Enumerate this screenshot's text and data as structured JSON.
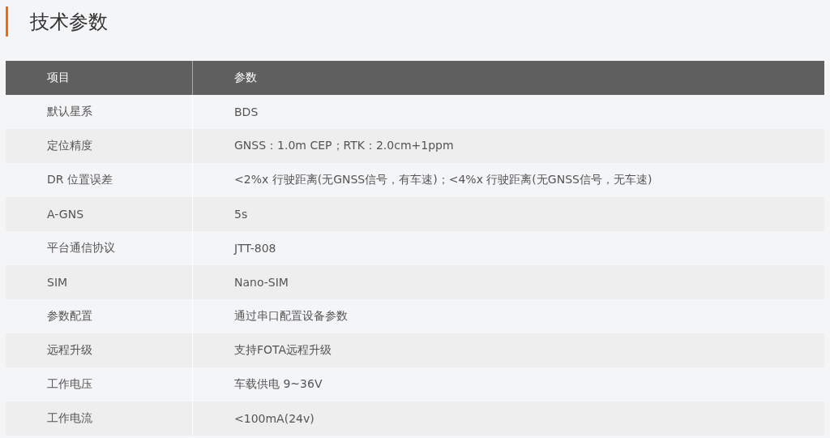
{
  "title": "技术参数",
  "table": {
    "columns": [
      "项目",
      "参数"
    ],
    "rows": [
      [
        "默认星系",
        "BDS"
      ],
      [
        "定位精度",
        "GNSS：1.0m CEP；RTK：2.0cm+1ppm"
      ],
      [
        "DR 位置误差",
        "<2%x 行驶距离(无GNSS信号，有车速)；<4%x 行驶距离(无GNSS信号，无车速)"
      ],
      [
        "A-GNS",
        "5s"
      ],
      [
        "平台通信协议",
        "JTT-808"
      ],
      [
        "SIM",
        "Nano-SIM"
      ],
      [
        "参数配置",
        "通过串口配置设备参数"
      ],
      [
        "远程升级",
        "支持FOTA远程升级"
      ],
      [
        "工作电压",
        "车载供电 9~36V"
      ],
      [
        "工作电流",
        "<100mA(24v)"
      ]
    ]
  }
}
